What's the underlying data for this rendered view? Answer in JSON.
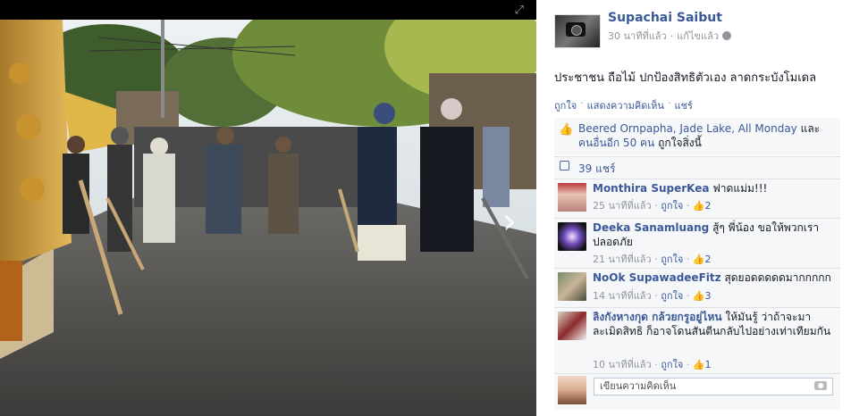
{
  "photo": {
    "alt": ""
  },
  "post": {
    "author": "Supachai Saibut",
    "time": "30 นาทีที่แล้ว",
    "edited": "แก้ไขแล้ว",
    "text": "ประชาชน ถือไม้ ปกป้องสิทธิตัวเอง ลาดกระบังโมเดล",
    "actions": {
      "like": "ถูกใจ",
      "comment": "แสดงความคิดเห็น",
      "share": "แชร์"
    }
  },
  "likes": {
    "names": "Beered Ornpapha, Jade Lake, All Monday",
    "conj": " และ ",
    "others": "คนอื่นอีก 50 คน",
    "suffix": " ถูกใจสิ่งนี้"
  },
  "shares": {
    "label": "39 แชร์"
  },
  "comments": [
    {
      "name": "Monthira SuperKea",
      "text": "ฟาดแม่ม!!!",
      "time": "25 นาทีที่แล้ว",
      "like": "ถูกใจ",
      "count": "2"
    },
    {
      "name": "Deeka Sanamluang",
      "text": "สู้ๆ พี่น้อง ขอให้พวกเราปลอดภัย",
      "time": "21 นาทีที่แล้ว",
      "like": "ถูกใจ",
      "count": "2"
    },
    {
      "name": "NoOk SupawadeeFitz",
      "text": "สุดยอดดดดดมากกกกก",
      "time": "14 นาทีที่แล้ว",
      "like": "ถูกใจ",
      "count": "3"
    },
    {
      "name": "ลิงกังหางกุด กล้วยกรูอยู่ไหน",
      "text": "ให้มันรู้ ว่าถ้าจะมาละเมิดสิทธิ ก็อาจโดนสันตีนกลับไปอย่างเท่าเทียมกัน",
      "time": "10 นาทีที่แล้ว",
      "like": "ถูกใจ",
      "count": "1"
    }
  ],
  "composer": {
    "placeholder": "เขียนความคิดเห็น"
  }
}
